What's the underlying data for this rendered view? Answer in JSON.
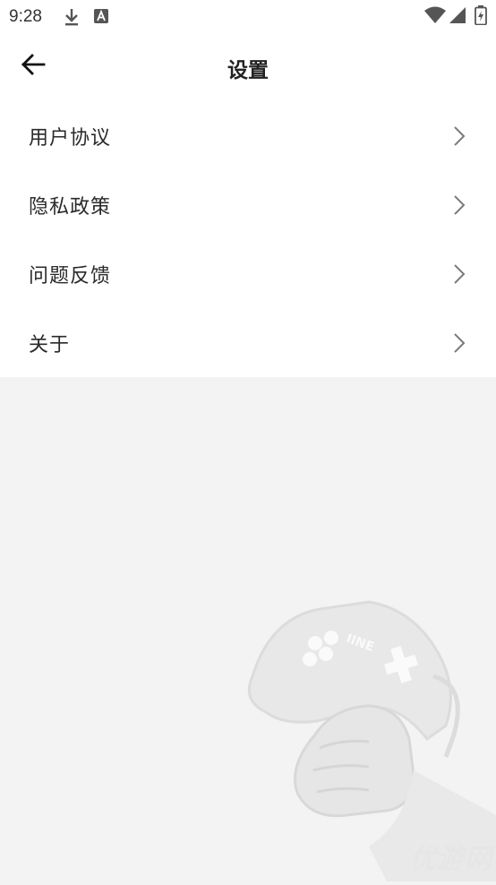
{
  "status_bar": {
    "time": "9:28",
    "icons": [
      "download-icon",
      "text-a-icon",
      "wifi-icon",
      "cell-signal-icon",
      "battery-charging-icon"
    ]
  },
  "header": {
    "title": "设置",
    "back_icon": "arrow-left-icon"
  },
  "menu": {
    "items": [
      {
        "label": "用户协议",
        "icon": "chevron-right-icon"
      },
      {
        "label": "隐私政策",
        "icon": "chevron-right-icon"
      },
      {
        "label": "问题反馈",
        "icon": "chevron-right-icon"
      },
      {
        "label": "关于",
        "icon": "chevron-right-icon"
      }
    ]
  },
  "decoration": {
    "gamepad_text": "IINE",
    "watermark": "优游网"
  },
  "colors": {
    "background": "#f3f3f3",
    "surface": "#ffffff",
    "text": "#222222",
    "chevron": "#7a7a7a"
  }
}
